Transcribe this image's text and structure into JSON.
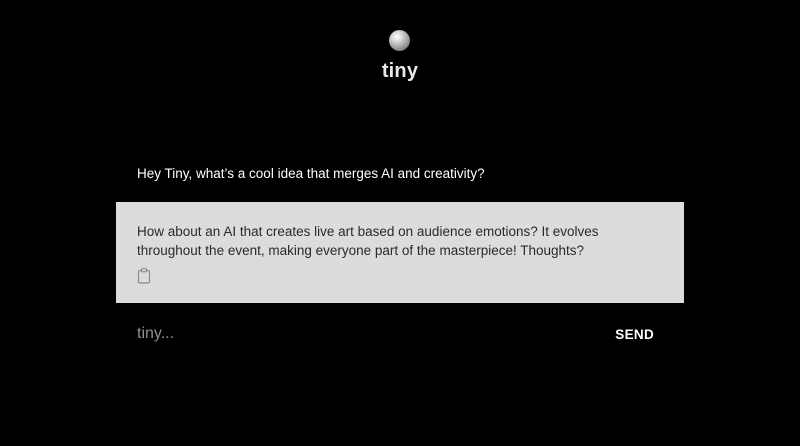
{
  "app": {
    "title": "tiny",
    "logo_icon": "moon-orb-icon"
  },
  "conversation": {
    "user_message": "Hey Tiny, what’s a cool idea that merges AI and creativity?",
    "assistant_message": "How about an AI that creates live art based on audience emotions? It evolves throughout the event, making everyone part of the masterpiece! Thoughts?",
    "assistant_action_icon": "clipboard-icon"
  },
  "composer": {
    "value": "",
    "placeholder": "tiny...",
    "send_label": "SEND"
  },
  "colors": {
    "background": "#000000",
    "assistant_card": "#dcdcdc",
    "assistant_text": "#2a2a2a",
    "user_text": "#ffffff",
    "placeholder": "#8f8f8f"
  }
}
